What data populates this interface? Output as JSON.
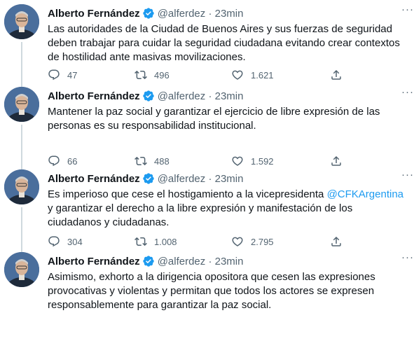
{
  "author": {
    "name": "Alberto Fernández",
    "handle": "@alferdez",
    "time": "23min"
  },
  "colors": {
    "text": "#0f1419",
    "secondary": "#536471",
    "accent": "#1d9bf0",
    "thread_line": "#cfd9de"
  },
  "icons": {
    "verified": "verified-badge-icon",
    "reply": "reply-icon",
    "retweet": "retweet-icon",
    "like": "heart-icon",
    "share": "share-icon",
    "more": "more-icon"
  },
  "tweets": [
    {
      "text": "Las autoridades de la Ciudad de Buenos Aires y sus fuerzas de seguridad deben trabajar para cuidar la seguridad ciudadana evitando crear contextos de hostilidad ante masivas movilizaciones.",
      "replies": "47",
      "retweets": "496",
      "likes": "1.621"
    },
    {
      "text": "Mantener la paz social y garantizar el ejercicio de libre expresión de las personas es su responsabilidad institucional.",
      "replies": "66",
      "retweets": "488",
      "likes": "1.592"
    },
    {
      "text_before": "Es imperioso que cese el hostigamiento a la vicepresidenta ",
      "mention": "@CFKArgentina",
      "text_after": " y garantizar el derecho a la libre expresión y manifestación de los ciudadanos y ciudadanas.",
      "replies": "304",
      "retweets": "1.008",
      "likes": "2.795"
    },
    {
      "text": "Asimismo, exhorto a la dirigencia opositora que cesen las expresiones provocativas y violentas y permitan que todos los actores se expresen responsablemente para garantizar la paz social."
    }
  ]
}
